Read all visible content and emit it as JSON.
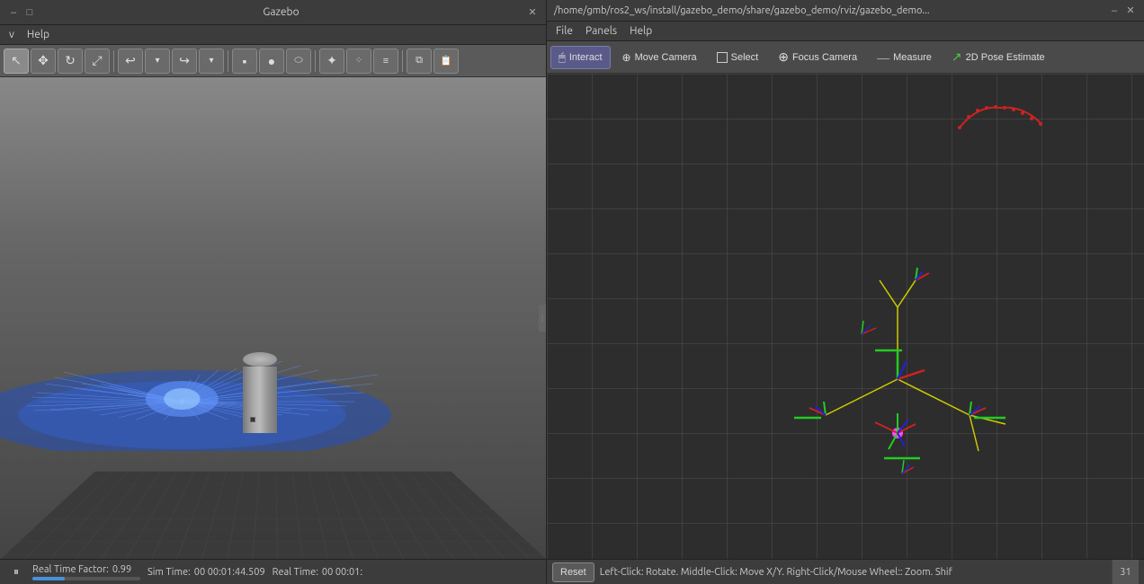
{
  "gazebo": {
    "title": "Gazebo",
    "window_controls": {
      "minimize": "–",
      "maximize": "□",
      "close": "✕"
    },
    "menu": {
      "items": [
        {
          "id": "view",
          "label": "v"
        },
        {
          "id": "help",
          "label": "Help"
        }
      ]
    },
    "toolbar": {
      "buttons": [
        {
          "id": "select",
          "icon": "↖",
          "tooltip": "Select"
        },
        {
          "id": "translate",
          "icon": "✥",
          "tooltip": "Translate"
        },
        {
          "id": "rotate",
          "icon": "↻",
          "tooltip": "Rotate"
        },
        {
          "id": "scale",
          "icon": "⤢",
          "tooltip": "Scale"
        },
        {
          "id": "undo",
          "icon": "↩",
          "tooltip": "Undo"
        },
        {
          "id": "redo",
          "icon": "↪",
          "tooltip": "Redo"
        },
        {
          "id": "box",
          "icon": "▪",
          "tooltip": "Box"
        },
        {
          "id": "sphere",
          "icon": "●",
          "tooltip": "Sphere"
        },
        {
          "id": "cylinder",
          "icon": "⬬",
          "tooltip": "Cylinder"
        },
        {
          "id": "light",
          "icon": "✦",
          "tooltip": "Light"
        },
        {
          "id": "pointcloud",
          "icon": "⁘",
          "tooltip": "Point Cloud"
        },
        {
          "id": "hatch",
          "icon": "≡",
          "tooltip": "Hatch"
        },
        {
          "id": "copy",
          "icon": "⧉",
          "tooltip": "Copy"
        },
        {
          "id": "paste",
          "icon": "📋",
          "tooltip": "Paste"
        }
      ]
    },
    "statusbar": {
      "pause_label": "⏸",
      "real_time_factor_label": "Real Time Factor:",
      "real_time_factor_value": "0.99",
      "sim_time_label": "Sim Time:",
      "sim_time_value": "00 00:01:44.509",
      "real_time_label": "Real Time:",
      "real_time_value": "00 00:01:"
    }
  },
  "rviz": {
    "titlebar": {
      "path": "/home/gmb/ros2_ws/install/gazebo_demo/share/gazebo_demo/rviz/gazebo_demo..."
    },
    "window_controls": {
      "minimize": "–",
      "close": "✕"
    },
    "menu": {
      "items": [
        {
          "id": "file",
          "label": "File"
        },
        {
          "id": "panels",
          "label": "Panels"
        },
        {
          "id": "help",
          "label": "Help"
        }
      ]
    },
    "toolbar": {
      "buttons": [
        {
          "id": "interact",
          "label": "Interact",
          "icon": "🖱",
          "active": true
        },
        {
          "id": "move-camera",
          "label": "Move Camera",
          "icon": "🎥"
        },
        {
          "id": "select",
          "label": "Select",
          "icon": "□"
        },
        {
          "id": "focus-camera",
          "label": "Focus Camera",
          "icon": "⊕"
        },
        {
          "id": "measure",
          "label": "Measure",
          "icon": "—"
        },
        {
          "id": "2d-pose-estimate",
          "label": "2D Pose Estimate",
          "icon": "/"
        }
      ]
    },
    "statusbar": {
      "reset_label": "Reset",
      "instructions": "Left-Click: Rotate.  Middle-Click: Move X/Y.  Right-Click/Mouse Wheel:: Zoom.  Shif",
      "fps": "31"
    }
  }
}
